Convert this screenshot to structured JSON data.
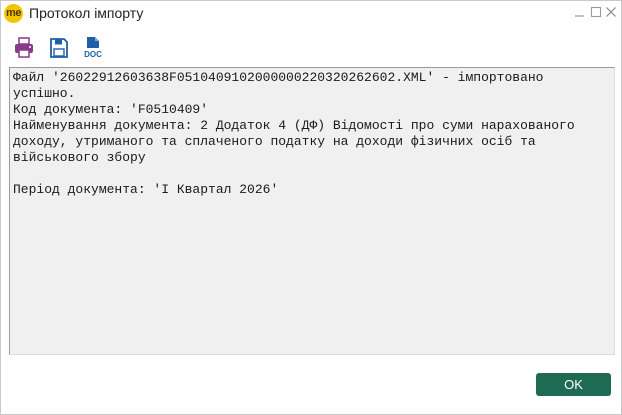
{
  "window": {
    "app_icon_text": "me",
    "title": "Протокол імпорту",
    "accent_color": "#1f6a52",
    "app_icon_color": "#f5c400"
  },
  "toolbar": {
    "buttons": [
      {
        "name": "print",
        "icon": "printer-icon",
        "color": "#8a3a8a"
      },
      {
        "name": "save",
        "icon": "floppy-disk-icon",
        "color": "#1f5fa8"
      },
      {
        "name": "export-doc",
        "icon": "doc-icon",
        "label": "DOC",
        "color": "#1f5fa8"
      }
    ]
  },
  "log": {
    "lines": [
      "Файл '26022912603638F0510409102000000220320262602.XML' - імпортовано успішно.",
      "Код документа: 'F0510409'",
      "Найменування документа: 2 Додаток 4 (ДФ) Відомості про суми нарахованого доходу, утриманого та сплаченого податку на доходи фізичних осіб та військового збору",
      "",
      "Період документа: 'І Квартал 2026'"
    ]
  },
  "footer": {
    "ok_label": "OK"
  }
}
